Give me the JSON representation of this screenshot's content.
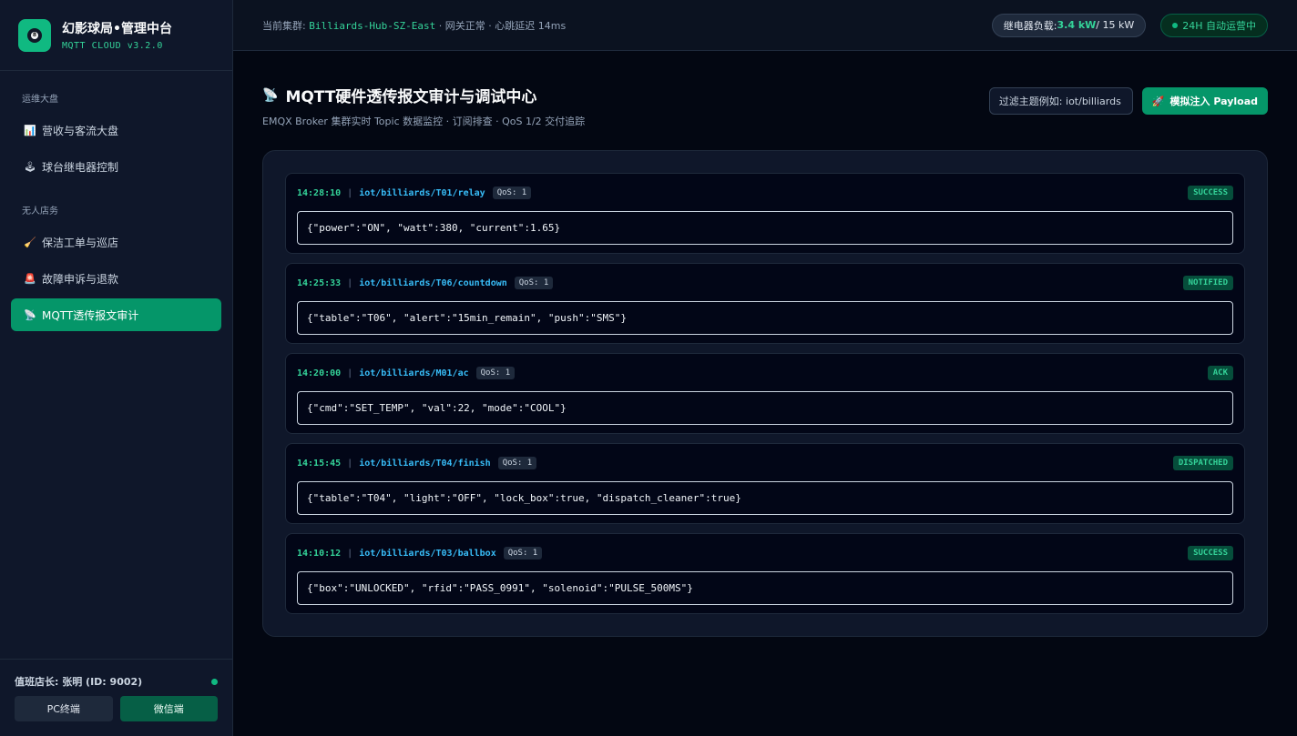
{
  "brand": {
    "title": "幻影球局•管理中台",
    "subtitle": "MQTT CLOUD v3.2.0",
    "logo_glyph": "8"
  },
  "sidebar": {
    "sections": [
      {
        "label": "运维大盘"
      },
      {
        "label": "无人店务"
      }
    ],
    "items": [
      {
        "icon": "📊",
        "icon_name": "bar-chart-icon",
        "label": "营收与客流大盘"
      },
      {
        "icon": "🕹",
        "icon_name": "joystick-icon",
        "label": "球台继电器控制"
      },
      {
        "icon": "🧹",
        "icon_name": "broom-icon",
        "label": "保洁工单与巡店"
      },
      {
        "icon": "🚨",
        "icon_name": "siren-icon",
        "label": "故障申诉与退款"
      },
      {
        "icon": "📡",
        "icon_name": "satellite-antenna-icon",
        "label": "MQTT透传报文审计",
        "active": true
      }
    ],
    "footer": {
      "user": "值班店长: 张明 (ID: 9002)",
      "pc_label": "PC终端",
      "wechat_label": "微信端"
    }
  },
  "topbar": {
    "cluster_prefix": "当前集群: ",
    "cluster_name": "Billiards-Hub-SZ-East",
    "cluster_suffix": " · 网关正常 · 心跳延迟 14ms",
    "load_label": "继电器负载: ",
    "load_value": "3.4 kW",
    "load_total": " / 15 kW",
    "auto_label": "24H 自动运营中"
  },
  "page": {
    "icon": "📡",
    "title": "MQTT硬件透传报文审计与调试中心",
    "subtitle": "EMQX Broker 集群实时 Topic 数据监控 · 订阅排查 · QoS 1/2 交付追踪",
    "filter_placeholder": "过滤主题例如: iot/billiards",
    "inject_icon": "🚀",
    "inject_label": "模拟注入 Payload"
  },
  "messages": [
    {
      "time": "14:28:10",
      "topic": "iot/billiards/T01/relay",
      "qos": "QoS: 1",
      "status": "SUCCESS",
      "payload": "{\"power\":\"ON\", \"watt\":380, \"current\":1.65}"
    },
    {
      "time": "14:25:33",
      "topic": "iot/billiards/T06/countdown",
      "qos": "QoS: 1",
      "status": "NOTIFIED",
      "payload": "{\"table\":\"T06\", \"alert\":\"15min_remain\", \"push\":\"SMS\"}"
    },
    {
      "time": "14:20:00",
      "topic": "iot/billiards/M01/ac",
      "qos": "QoS: 1",
      "status": "ACK",
      "payload": "{\"cmd\":\"SET_TEMP\", \"val\":22, \"mode\":\"COOL\"}"
    },
    {
      "time": "14:15:45",
      "topic": "iot/billiards/T04/finish",
      "qos": "QoS: 1",
      "status": "DISPATCHED",
      "payload": "{\"table\":\"T04\", \"light\":\"OFF\", \"lock_box\":true, \"dispatch_cleaner\":true}"
    },
    {
      "time": "14:10:12",
      "topic": "iot/billiards/T03/ballbox",
      "qos": "QoS: 1",
      "status": "SUCCESS",
      "payload": "{\"box\":\"UNLOCKED\", \"rfid\":\"PASS_0991\", \"solenoid\":\"PULSE_500MS\"}"
    }
  ],
  "colors": {
    "accent": "#059669",
    "accent_text": "#34d399",
    "topic": "#38bdf8",
    "background": "#030712"
  }
}
